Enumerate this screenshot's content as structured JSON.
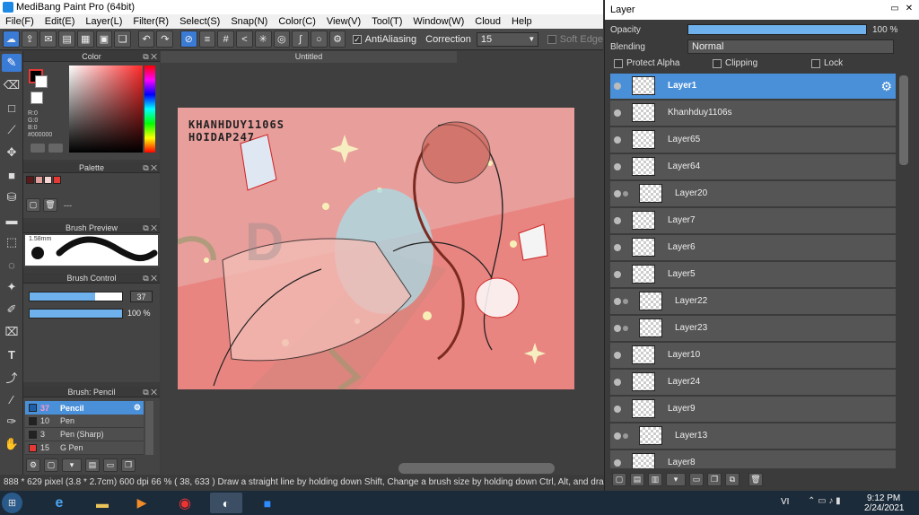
{
  "app": {
    "title": "MediBang Paint Pro (64bit)"
  },
  "menu": [
    "File(F)",
    "Edit(E)",
    "Layer(L)",
    "Filter(R)",
    "Select(S)",
    "Snap(N)",
    "Color(C)",
    "View(V)",
    "Tool(T)",
    "Window(W)",
    "Cloud",
    "Help"
  ],
  "toolbar": {
    "antialiasing_label": "AntiAliasing",
    "correction_label": "Correction",
    "correction_value": "15",
    "soft_edge_label": "Soft Edge"
  },
  "color_panel": {
    "title": "Color",
    "r": "R:0",
    "g": "G:0",
    "b": "B:0",
    "hex": "#000000"
  },
  "palette_panel": {
    "title": "Palette",
    "placeholder": "---"
  },
  "brush_preview": {
    "title": "Brush Preview",
    "size": "1.58mm"
  },
  "brush_control": {
    "title": "Brush Control",
    "size_value": "37",
    "opacity_value": "100 %",
    "size_fill": 0.71,
    "opacity_fill": 1.0
  },
  "brush_list": {
    "title": "Brush: Pencil",
    "items": [
      {
        "size": "37",
        "name": "Pencil",
        "color": "#1f5fa8",
        "selected": true
      },
      {
        "size": "10",
        "name": "Pen",
        "color": "#222222",
        "selected": false
      },
      {
        "size": "3",
        "name": "Pen (Sharp)",
        "color": "#222222",
        "selected": false
      },
      {
        "size": "15",
        "name": "G Pen",
        "color": "#e53935",
        "selected": false
      }
    ]
  },
  "document": {
    "tab": "Untitled",
    "watermark_line1": "KHANHDUY1106S",
    "watermark_line2": "HOIDAP247"
  },
  "status": {
    "text": "888 * 629 pixel  (3.8 * 2.7cm)  600 dpi  66 %  ( 38, 633 )  Draw a straight line by holding down Shift, Change a brush size by holding down Ctrl, Alt, and dragging"
  },
  "layer_panel": {
    "title": "Layer",
    "opacity_label": "Opacity",
    "opacity_value": "100 %",
    "opacity_fill": 1.0,
    "blending_label": "Blending",
    "blending_value": "Normal",
    "protect_alpha": "Protect Alpha",
    "clipping": "Clipping",
    "lock": "Lock",
    "layers": [
      {
        "name": "Layer1",
        "selected": true,
        "indent": false
      },
      {
        "name": "Khanhduy1106s",
        "selected": false,
        "indent": false
      },
      {
        "name": "Layer65",
        "selected": false,
        "indent": false
      },
      {
        "name": "Layer64",
        "selected": false,
        "indent": false
      },
      {
        "name": "Layer20",
        "selected": false,
        "indent": true
      },
      {
        "name": "Layer7",
        "selected": false,
        "indent": false
      },
      {
        "name": "Layer6",
        "selected": false,
        "indent": false
      },
      {
        "name": "Layer5",
        "selected": false,
        "indent": false
      },
      {
        "name": "Layer22",
        "selected": false,
        "indent": true
      },
      {
        "name": "Layer23",
        "selected": false,
        "indent": true
      },
      {
        "name": "Layer10",
        "selected": false,
        "indent": false
      },
      {
        "name": "Layer24",
        "selected": false,
        "indent": false
      },
      {
        "name": "Layer9",
        "selected": false,
        "indent": false
      },
      {
        "name": "Layer13",
        "selected": false,
        "indent": true
      },
      {
        "name": "Layer8",
        "selected": false,
        "indent": false
      }
    ]
  },
  "taskbar": {
    "lang": "VI",
    "time": "9:12 PM",
    "date": "2/24/2021"
  },
  "colors": {
    "accent": "#3a7bd5",
    "canvas_bg": "#e89e9b",
    "fore": "#000000",
    "palette": [
      "#5a1a1a",
      "#e3a19e",
      "#f5d4d2",
      "#e53935"
    ]
  }
}
